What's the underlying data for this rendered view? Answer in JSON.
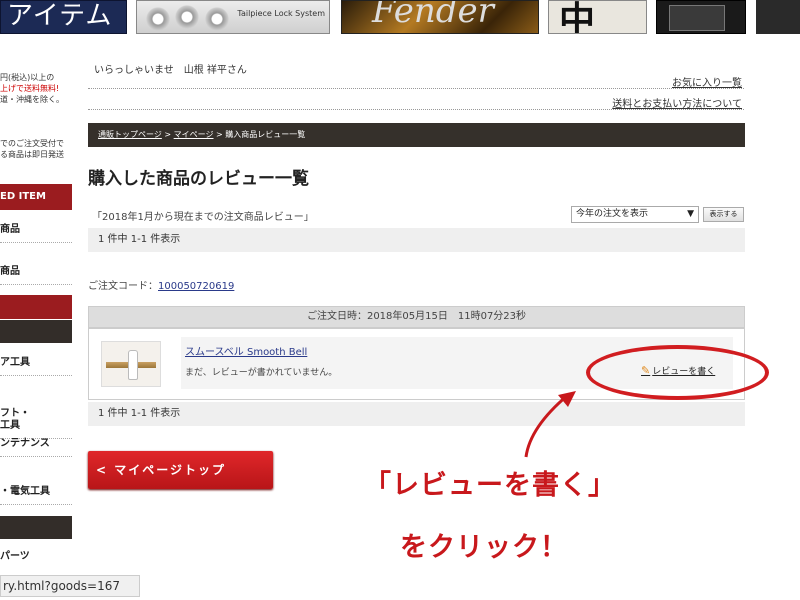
{
  "banners": {
    "b1_text": "アイテム",
    "b2_text": "Tailpiece Lock System",
    "b3_text": "Fender",
    "b4_text": "中"
  },
  "sidebar": {
    "notice1_lines": [
      "円(税込)以上の",
      "上げで送料無料!",
      "道・沖縄を除く。"
    ],
    "notice2_lines": [
      "でのご注文受付で",
      "る商品は即日発送"
    ],
    "header_text": "ED ITEM",
    "items": [
      {
        "label": "商品"
      },
      {
        "label": "商品"
      },
      {
        "label": "ア工具"
      },
      {
        "label": "フト・\n工具"
      },
      {
        "label": "ンテナンス"
      },
      {
        "label": "・電気工具"
      },
      {
        "label": "パーツ"
      }
    ]
  },
  "header": {
    "greeting": "いらっしゃいませ　山根 祥平さん",
    "favorites_link": "お気に入り一覧",
    "shipping_link": "送料とお支払い方法について"
  },
  "breadcrumb": {
    "home": "通販トップページ",
    "sep1": " > ",
    "mypage": "マイページ",
    "sep2": " > ",
    "current": "購入商品レビュー一覧"
  },
  "main": {
    "title": "購入した商品のレビュー一覧",
    "period_text": "「2018年1月から現在までの注文商品レビュー」",
    "order_select": "今年の注文を表示",
    "show_button": "表示する",
    "count_text": "1 件中 1-1 件表示",
    "order_code_label": "ご注文コード：",
    "order_code": "100050720619",
    "order_date": "ご注文日時：2018年05月15日　11時07分23秒",
    "product_name": "スムースベル Smooth Bell",
    "not_written": "まだ、レビューが書かれていません。",
    "write_review": "レビューを書く",
    "mypage_button": "< マイページトップ"
  },
  "annotation": {
    "line1": "「レビューを書く」",
    "line2": "をクリック！",
    "color": "#c8181c"
  },
  "statusbar": {
    "url": "ry.html?goods=167"
  }
}
